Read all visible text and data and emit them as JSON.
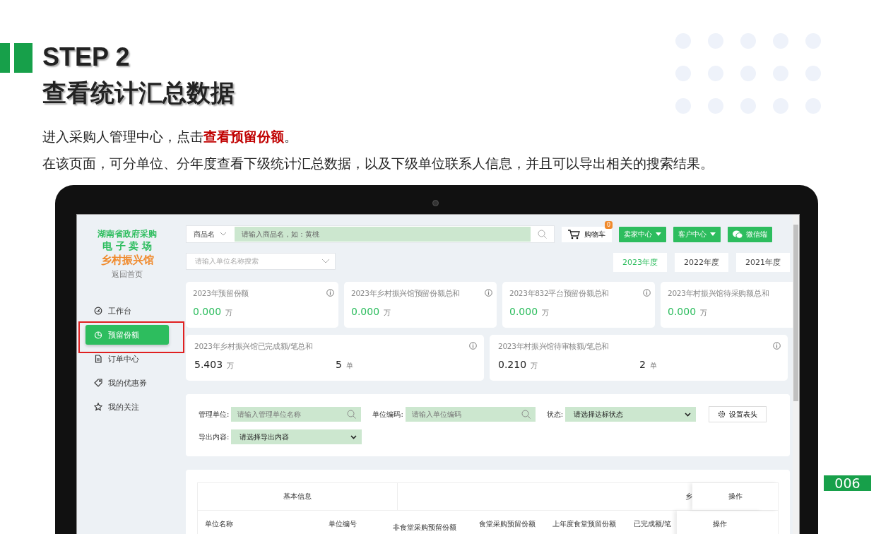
{
  "slide": {
    "step": "STEP 2",
    "title": "查看统计汇总数据",
    "paragraphs": [
      "进入采购人管理中心，点击**查看预留份额**。",
      "在该页面，可分单位、分年度查看下级统计汇总数据，以及下级单位联系人信息，并且可以导出相关的搜索结果。"
    ],
    "page_number": "006"
  },
  "app": {
    "logo": {
      "line_1": "湖南省政府采购",
      "line_2": "电 子 卖 场",
      "line_3": "乡村振兴馆"
    },
    "back_link": "返回首页",
    "nav": [
      {
        "label": "工作台",
        "kind": "dashboard",
        "selected": false
      },
      {
        "label": "预留份额",
        "kind": "pie",
        "selected": true
      },
      {
        "label": "订单中心",
        "kind": "document",
        "selected": false
      },
      {
        "label": "我的优惠券",
        "kind": "tag",
        "selected": false
      },
      {
        "label": "我的关注",
        "kind": "star",
        "selected": false
      }
    ],
    "search": {
      "category": "商品名",
      "placeholder": "请输入商品名，如：黄桃"
    },
    "cart": {
      "label": "购物车",
      "badge": "0"
    },
    "header_buttons": [
      {
        "label": "卖家中心",
        "kind": "dropdown"
      },
      {
        "label": "客户中心",
        "kind": "dropdown"
      },
      {
        "label": "微信端",
        "kind": "wechat"
      }
    ],
    "unit_search": {
      "placeholder": "请输入单位名称搜索"
    },
    "years": [
      {
        "label": "2023年度",
        "selected": true
      },
      {
        "label": "2022年度",
        "selected": false
      },
      {
        "label": "2021年度",
        "selected": false
      }
    ],
    "stat_cards": [
      {
        "title": "2023年预留份额",
        "kind": "amount",
        "values": [
          {
            "value": "0.000",
            "unit": "万"
          }
        ]
      },
      {
        "title": "2023年乡村振兴馆预留份额总和",
        "kind": "amount",
        "values": [
          {
            "value": "0.000",
            "unit": "万"
          }
        ]
      },
      {
        "title": "2023年832平台预留份额总和",
        "kind": "amount",
        "values": [
          {
            "value": "0.000",
            "unit": "万"
          }
        ]
      },
      {
        "title": "2023年村振兴馆待采购额总和",
        "kind": "amount",
        "values": [
          {
            "value": "0.000",
            "unit": "万"
          }
        ]
      },
      {
        "title": "2023年乡村振兴馆已完成额/笔总和",
        "kind": "count",
        "values": [
          {
            "value": "5.403",
            "unit": "万"
          },
          {
            "value": "5",
            "unit": "单"
          }
        ]
      },
      {
        "title": "2023年村振兴馆待审核额/笔总和",
        "kind": "count",
        "values": [
          {
            "value": "0.210",
            "unit": "万"
          },
          {
            "value": "2",
            "unit": "单"
          }
        ]
      }
    ],
    "filters": [
      {
        "label": "管理单位:",
        "kind": "search",
        "placeholder": "请输入管理单位名称"
      },
      {
        "label": "单位编码:",
        "kind": "search",
        "placeholder": "请输入单位编码"
      },
      {
        "label": "状态:",
        "kind": "select",
        "value": "请选择达标状态"
      },
      {
        "label": "导出内容:",
        "kind": "select",
        "value": "请选择导出内容"
      }
    ],
    "settings_button": "设置表头",
    "table": {
      "group_headers": [
        "基本信息",
        "乡",
        "操作"
      ],
      "columns": [
        "单位名称",
        "单位编号",
        "非食堂采购预留份额",
        "食堂采购预留份额",
        "上年度食堂预留份额",
        "已完成额/笔",
        "操作"
      ]
    }
  }
}
